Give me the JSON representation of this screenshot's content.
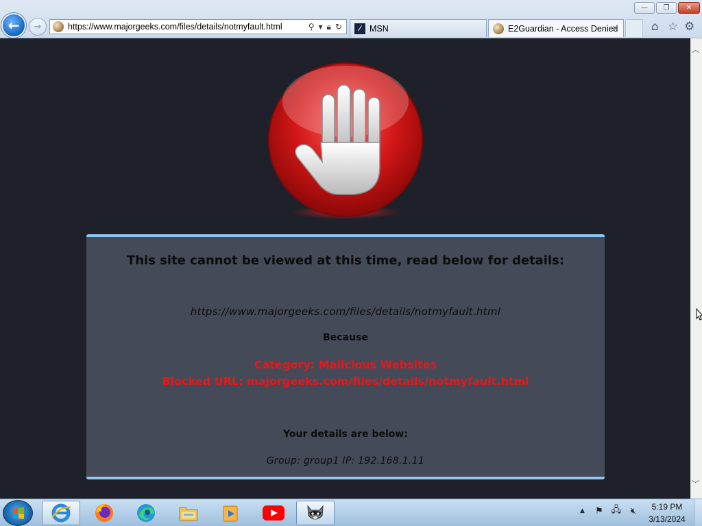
{
  "browser": {
    "address_url": "https://www.majorgeeks.com/files/details/notmyfault.html",
    "tabs": [
      {
        "label": "MSN",
        "icon": "msn-icon"
      },
      {
        "label": "E2Guardian - Access Denied",
        "icon": "site-favicon",
        "active": true
      }
    ],
    "window_controls": {
      "minimize": "—",
      "maximize": "❐",
      "close": "✕"
    }
  },
  "page": {
    "headline": "This site cannot be viewed at this time, read below for details:",
    "blocked_url": "https://www.majorgeeks.com/files/details/notmyfault.html",
    "because_label": "Because",
    "category_line": "Category: Malicious Websites",
    "blocked_line": "Blocked URL: majorgeeks.com/files/details/notmyfault.html",
    "details_heading": "Your details are below:",
    "details_line": "Group: group1   IP: 192.168.1.11",
    "colors": {
      "background": "#1e2129",
      "panel": "#454a59",
      "panel_border": "#8fc6ec",
      "alert_text": "#f01414"
    }
  },
  "taskbar": {
    "apps": [
      "internet-explorer",
      "firefox",
      "edge",
      "file-explorer",
      "media-player",
      "youtube",
      "raccoon-app"
    ],
    "clock_time": "5:19 PM",
    "clock_date": "3/13/2024"
  }
}
